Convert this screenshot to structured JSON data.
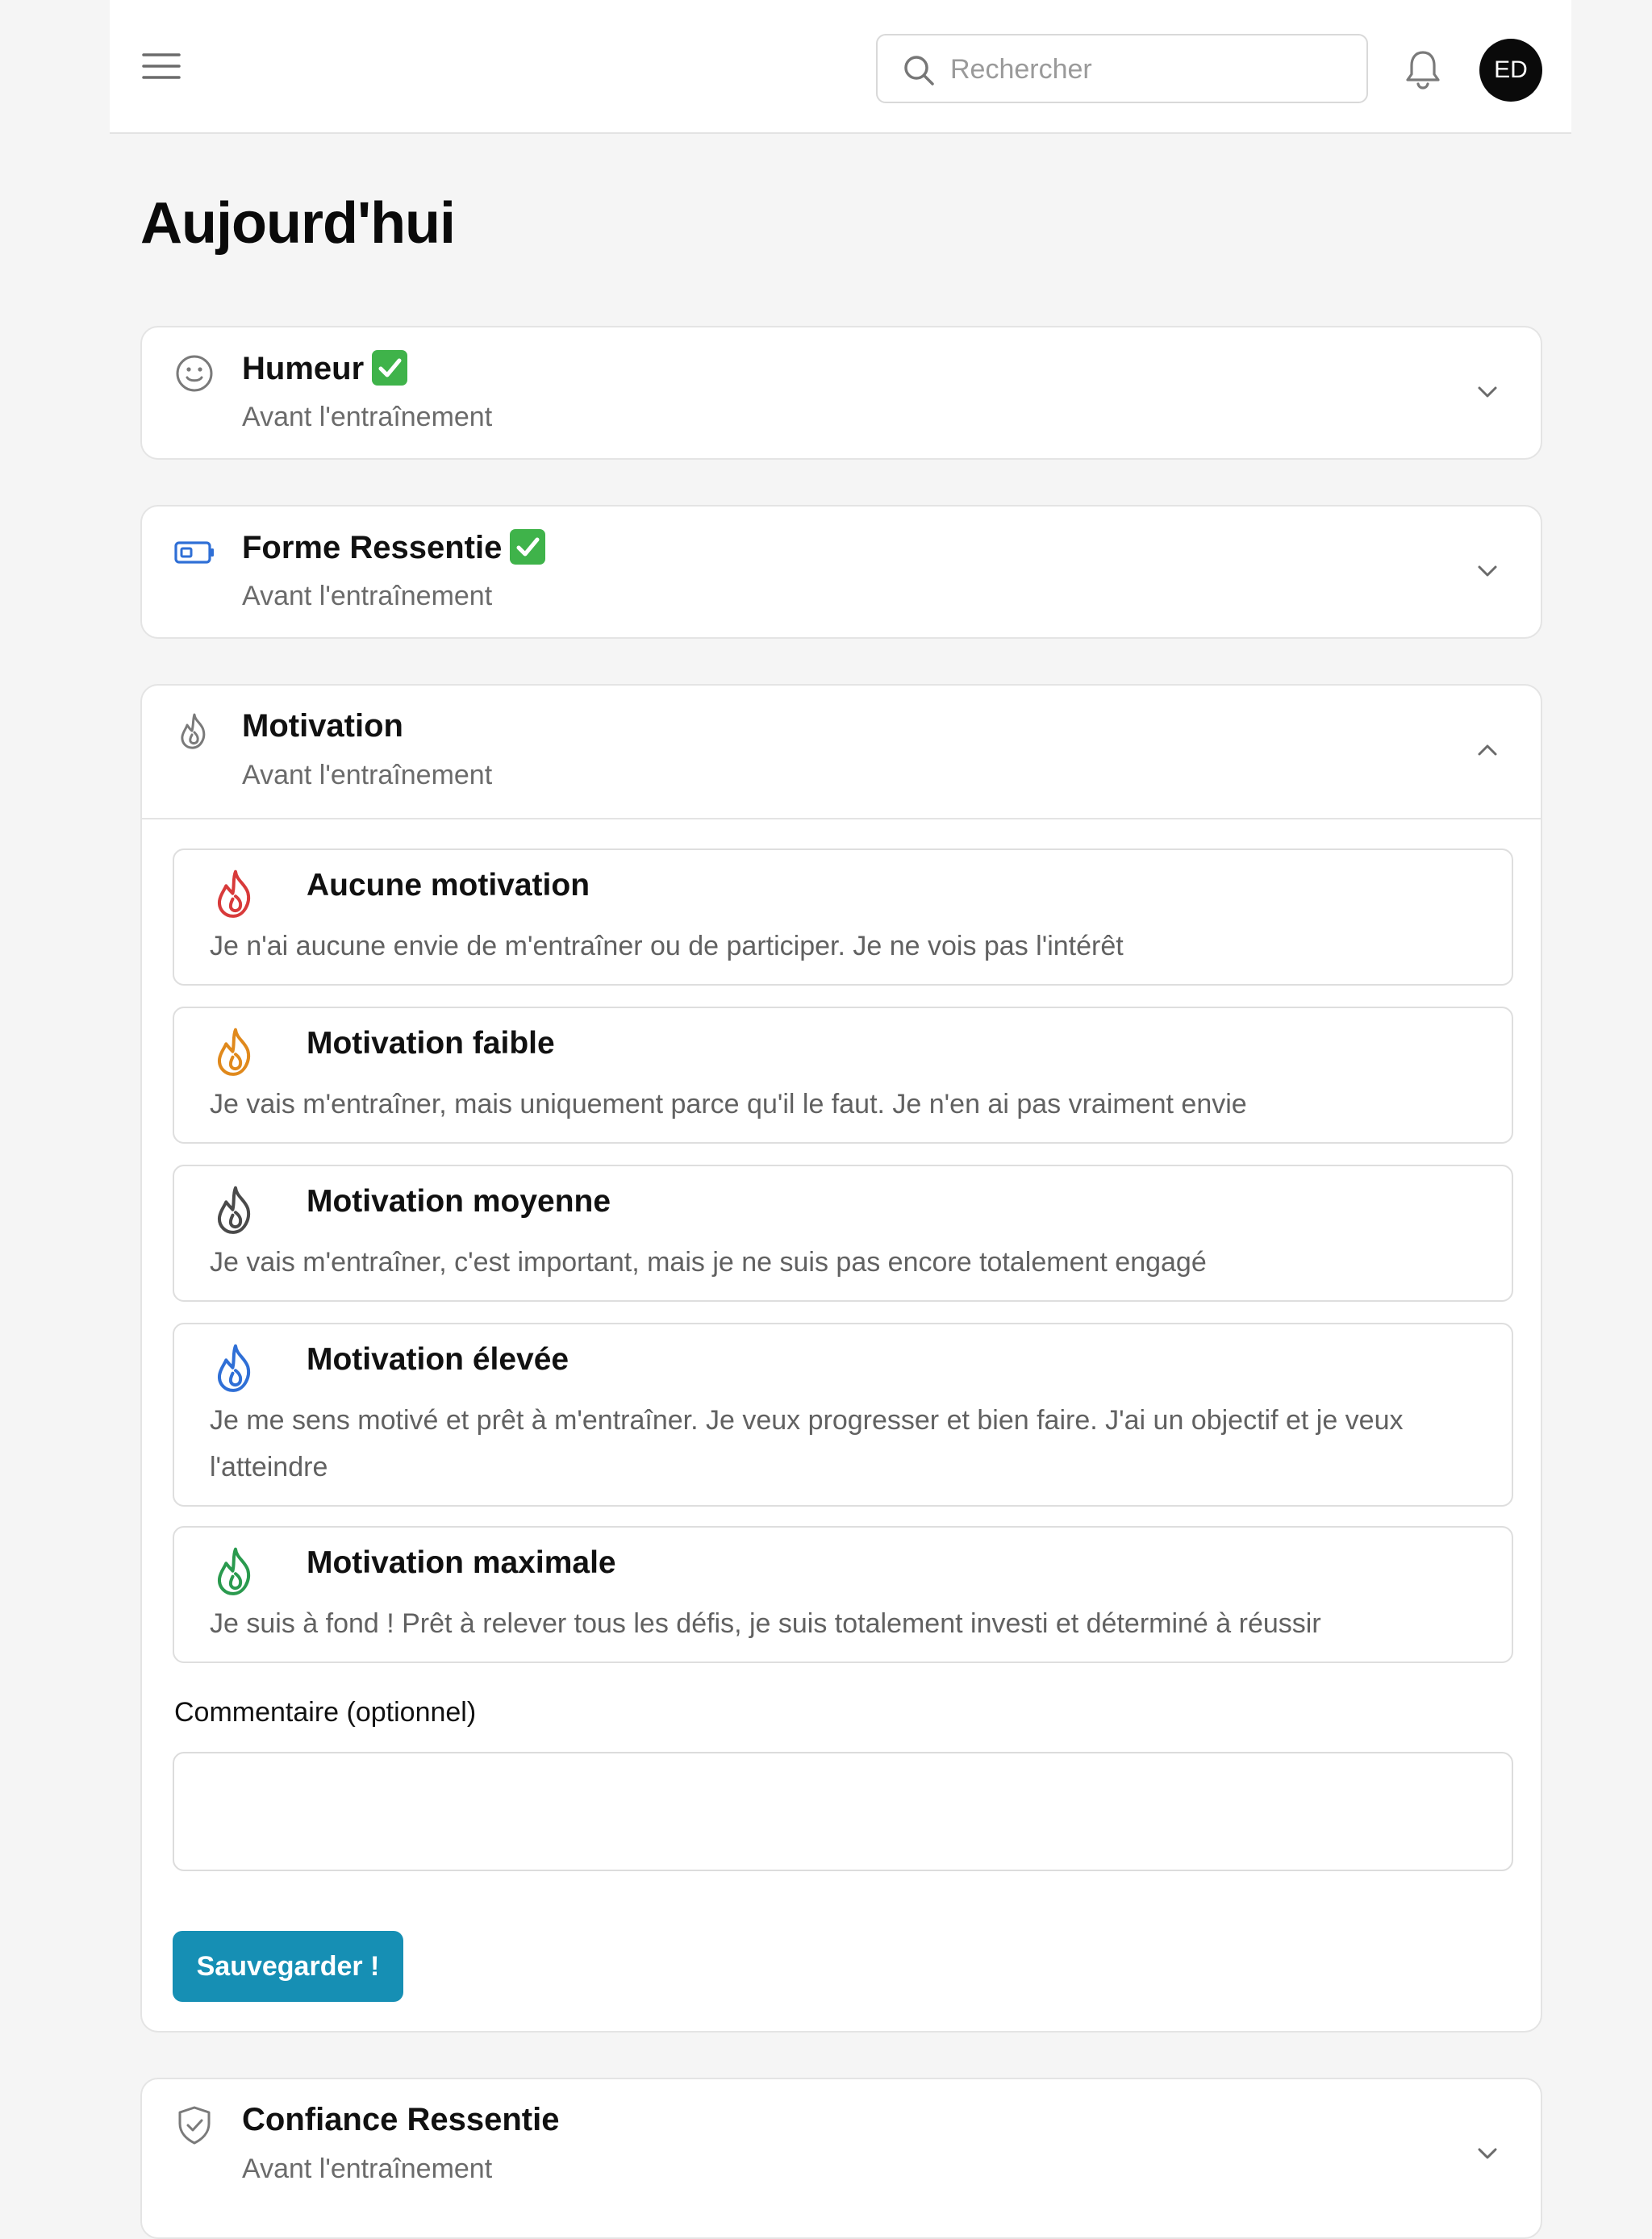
{
  "header": {
    "search_placeholder": "Rechercher",
    "avatar_initials": "ED"
  },
  "page_title": "Aujourd'hui",
  "sections": {
    "humeur": {
      "title": "Humeur",
      "subtitle": "Avant l'entraînement",
      "completed": true
    },
    "forme": {
      "title": "Forme Ressentie",
      "subtitle": "Avant l'entraînement",
      "completed": true
    },
    "motivation": {
      "title": "Motivation",
      "subtitle": "Avant l'entraînement",
      "expanded": true
    },
    "confiance": {
      "title": "Confiance Ressentie",
      "subtitle": "Avant l'entraînement"
    }
  },
  "motivation_options": [
    {
      "title": "Aucune motivation",
      "description": "Je n'ai aucune envie de m'entraîner ou de participer. Je ne vois pas l'intérêt",
      "color": "#d83a3a"
    },
    {
      "title": "Motivation faible",
      "description": "Je vais m'entraîner, mais uniquement parce qu'il le faut. Je n'en ai pas vraiment envie",
      "color": "#e0891c"
    },
    {
      "title": "Motivation moyenne",
      "description": "Je vais m'entraîner, c'est important, mais je ne suis pas encore totalement engagé",
      "color": "#4a4a4a"
    },
    {
      "title": "Motivation élevée",
      "description": "Je me sens motivé et prêt à m'entraîner. Je veux progresser et bien faire. J'ai un objectif et je veux l'atteindre",
      "color": "#2f6fd6"
    },
    {
      "title": "Motivation maximale",
      "description": "Je suis à fond ! Prêt à relever tous les défis, je suis totalement investi et déterminé à réussir",
      "color": "#2a9a4e"
    }
  ],
  "comment": {
    "label": "Commentaire (optionnel)",
    "value": ""
  },
  "save_label": "Sauvegarder !",
  "colors": {
    "accent": "#168fb4",
    "check_green": "#3fb34a",
    "battery_blue": "#2f6fd6"
  },
  "icons": {
    "menu": "hamburger-icon",
    "search": "search-icon",
    "bell": "bell-icon",
    "humeur": "smiley-icon",
    "forme": "battery-icon",
    "motivation": "flame-icon",
    "confiance": "shield-check-icon"
  }
}
